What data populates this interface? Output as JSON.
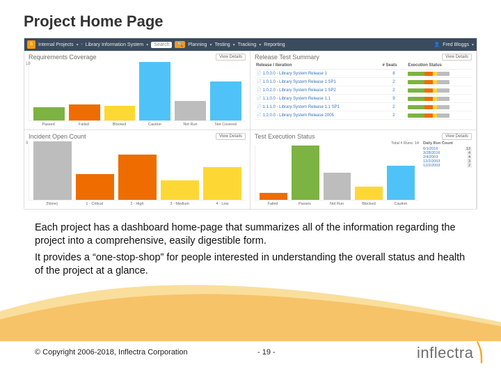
{
  "slide": {
    "title": "Project Home Page",
    "body_p1": "Each project has a dashboard home-page that summarizes all of the information regarding the project into a comprehensive, easily digestible form.",
    "body_p2": "It provides a “one-stop-shop” for people interested in understanding the overall status and health of the project at a glance.",
    "copyright": "© Copyright 2006-2018, Inflectra Corporation",
    "page": "- 19 -",
    "brand": "inflectra"
  },
  "toolbar": {
    "internal": "Internal Projects",
    "project": "Library Information System",
    "search_placeholder": "Search",
    "planning": "Planning",
    "testing": "Testing",
    "tracking": "Tracking",
    "reporting": "Reporting",
    "user": "Fred Bloggs"
  },
  "widgets": {
    "viewdetails": "View Details",
    "req_cov": {
      "title": "Requirements Coverage"
    },
    "rts": {
      "title": "Release Test Summary",
      "col_release": "Release / Iteration",
      "col_seats": "# Seats",
      "col_exec": "Execution Status",
      "rows": [
        {
          "name": "1.0.0.0 - Library System Release 1",
          "seats": "8"
        },
        {
          "name": "1.0.1.0 - Library System Release 1 SP1",
          "seats": "2"
        },
        {
          "name": "1.0.2.0 - Library System Release 1 SP2",
          "seats": "2"
        },
        {
          "name": "1.1.0.0 - Library System Release 1.1",
          "seats": "9"
        },
        {
          "name": "1.1.1.0 - Library System Release 1.1 SP1",
          "seats": "2"
        },
        {
          "name": "1.2.0.0 - Library System Release 2005",
          "seats": "2"
        }
      ]
    },
    "ioc": {
      "title": "Incident Open Count"
    },
    "tes": {
      "title": "Test Execution Status",
      "total": "Total # Runs: 14",
      "side_title": "Daily Run Count",
      "runs": [
        {
          "d": "6/1/2016",
          "c": "13"
        },
        {
          "d": "3/28/2016",
          "c": "4"
        },
        {
          "d": "2/4/2003",
          "c": "4"
        },
        {
          "d": "12/2/2003",
          "c": "3"
        },
        {
          "d": "12/2/2003",
          "c": "2"
        }
      ]
    }
  },
  "chart_data": [
    {
      "id": "requirements_coverage",
      "type": "bar",
      "categories": [
        "Passed",
        "Failed",
        "Blocked",
        "Caution",
        "Not Run",
        "Not Covered"
      ],
      "values": [
        4,
        5,
        4.5,
        18,
        6,
        12
      ],
      "colors": [
        "#7cb342",
        "#ef6c00",
        "#fdd835",
        "#4fc3f7",
        "#bdbdbd",
        "#4fc3f7"
      ],
      "ylim": [
        0,
        18
      ],
      "ytick": 18
    },
    {
      "id": "incident_open_count",
      "type": "bar",
      "categories": [
        "(None)",
        "1 - Critical",
        "2 - High",
        "3 - Medium",
        "4 - Low"
      ],
      "values": [
        9,
        4,
        7,
        3,
        5
      ],
      "colors": [
        "#bdbdbd",
        "#ef6c00",
        "#ef6c00",
        "#fdd835",
        "#fdd835"
      ],
      "ylim": [
        0,
        9
      ],
      "ytick": 9
    },
    {
      "id": "test_execution_status",
      "type": "bar",
      "categories": [
        "Failed",
        "Passes",
        "Not Run",
        "Blocked",
        "Caution"
      ],
      "values": [
        1,
        8,
        4,
        2,
        5
      ],
      "colors": [
        "#ef6c00",
        "#7cb342",
        "#bdbdbd",
        "#fdd835",
        "#4fc3f7"
      ],
      "ylim": [
        0,
        8
      ]
    }
  ]
}
